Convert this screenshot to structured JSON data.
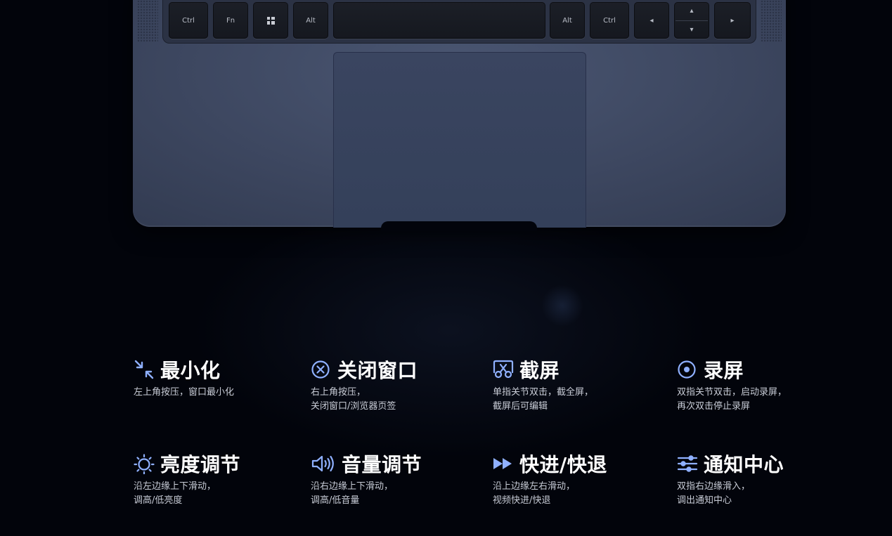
{
  "keyboard": {
    "keys": [
      {
        "label": "Ctrl"
      },
      {
        "label": "Fn"
      },
      {
        "label": ""
      },
      {
        "label": "Alt"
      },
      {
        "label": ""
      },
      {
        "label": "Alt"
      },
      {
        "label": "Ctrl"
      },
      {
        "label": "◂"
      },
      {
        "label": "▴",
        "label2": "▾"
      },
      {
        "label": "▸"
      }
    ]
  },
  "accent_color": "#8fb0ff",
  "features": [
    {
      "icon": "minimize-icon",
      "title": "最小化",
      "desc": [
        "左上角按压，窗口最小化"
      ]
    },
    {
      "icon": "close-window-icon",
      "title": "关闭窗口",
      "desc": [
        "右上角按压，",
        "关闭窗口/浏览器页签"
      ]
    },
    {
      "icon": "screenshot-icon",
      "title": "截屏",
      "desc": [
        "单指关节双击，截全屏，",
        "截屏后可编辑"
      ]
    },
    {
      "icon": "screen-record-icon",
      "title": "录屏",
      "desc": [
        "双指关节双击，启动录屏，",
        "再次双击停止录屏"
      ]
    },
    {
      "icon": "brightness-icon",
      "title": "亮度调节",
      "desc": [
        "沿左边缘上下滑动，",
        "调高/低亮度"
      ]
    },
    {
      "icon": "volume-icon",
      "title": "音量调节",
      "desc": [
        "沿右边缘上下滑动，",
        "调高/低音量"
      ]
    },
    {
      "icon": "fast-forward-icon",
      "title": "快进/快退",
      "desc": [
        "沿上边缘左右滑动，",
        "视频快进/快退"
      ]
    },
    {
      "icon": "notification-center-icon",
      "title": "通知中心",
      "desc": [
        "双指右边缘滑入，",
        "调出通知中心"
      ]
    }
  ]
}
